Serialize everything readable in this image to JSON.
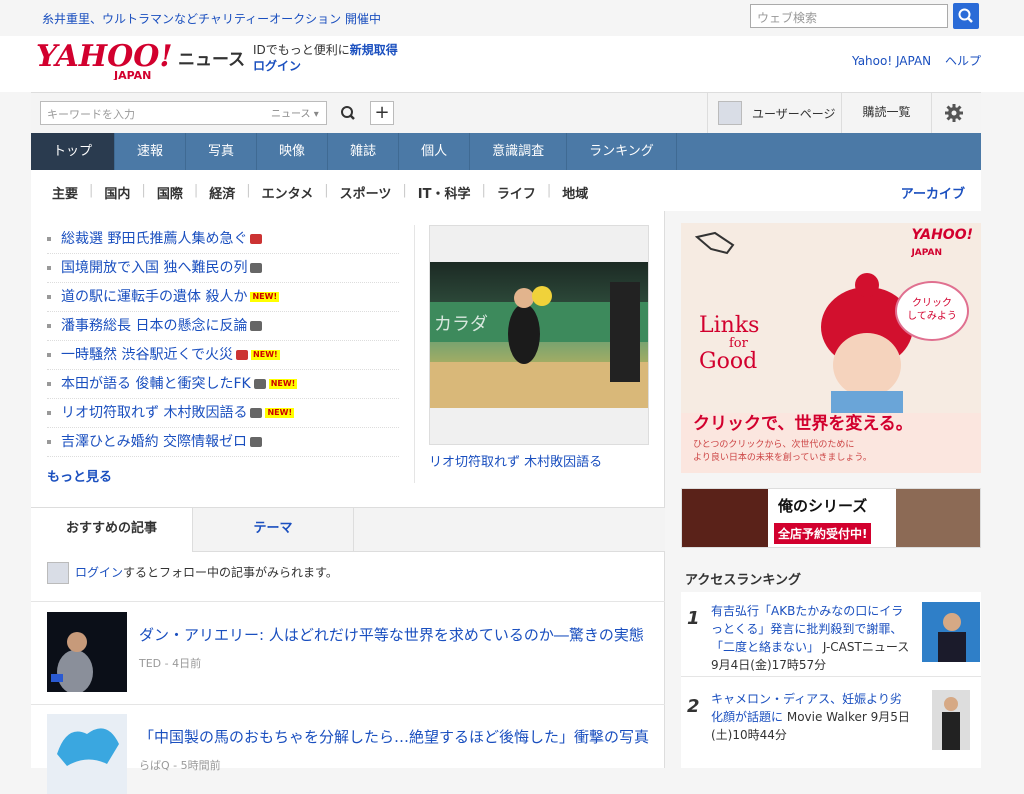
{
  "top": {
    "promo": "糸井重里、ウルトラマンなどチャリティーオークション 開催中",
    "websearch_placeholder": "ウェブ検索"
  },
  "header": {
    "logo_text": "YAHOO!",
    "logo_sub": "JAPAN",
    "section": "ニュース",
    "login_line1_prefix": "IDでもっと便利に",
    "register": "新規取得",
    "login": "ログイン",
    "yahoo_japan": "Yahoo! JAPAN",
    "help": "ヘルプ"
  },
  "search": {
    "placeholder": "キーワードを入力",
    "scope": "ニュース",
    "user_page": "ユーザーページ",
    "subscriptions": "購読一覧"
  },
  "mainnav": [
    "トップ",
    "速報",
    "写真",
    "映像",
    "雑誌",
    "個人",
    "意識調査",
    "ランキング"
  ],
  "subnav": [
    "主要",
    "国内",
    "国際",
    "経済",
    "エンタメ",
    "スポーツ",
    "IT・科学",
    "ライフ",
    "地域"
  ],
  "archive": "アーカイブ",
  "topics": [
    {
      "text": "総裁選 野田氏推薦人集め急ぐ",
      "icon": "video-icon",
      "new": false
    },
    {
      "text": "国境開放で入国 独へ難民の列",
      "icon": "camera-icon",
      "new": false
    },
    {
      "text": "道の駅に運転手の遺体 殺人か",
      "icon": "",
      "new": true
    },
    {
      "text": "潘事務総長 日本の懸念に反論",
      "icon": "camera-icon",
      "new": false
    },
    {
      "text": "一時騒然 渋谷駅近くで火災",
      "icon": "video-icon",
      "new": true
    },
    {
      "text": "本田が語る 俊輔と衝突したFK",
      "icon": "camera-icon",
      "new": true
    },
    {
      "text": "リオ切符取れず 木村敗因語る",
      "icon": "camera-icon",
      "new": true
    },
    {
      "text": "吉澤ひとみ婚約 交際情報ゼロ",
      "icon": "camera-icon",
      "new": false
    }
  ],
  "new_label": "NEW!",
  "more": "もっと見る",
  "photo_caption": "リオ切符取れず 木村敗因語る",
  "tabs": {
    "recommended": "おすすめの記事",
    "theme": "テーマ"
  },
  "login_hint": {
    "link": "ログイン",
    "rest": "するとフォロー中の記事がみられます。"
  },
  "articles": [
    {
      "title": "ダン・アリエリー: 人はどれだけ平等な世界を求めているのか―驚きの実態",
      "source": "TED",
      "time": "4日前"
    },
    {
      "title": "「中国製の馬のおもちゃを分解したら…絶望するほど後悔した」衝撃の写真",
      "source": "らばQ",
      "time": "5時間前"
    }
  ],
  "ads": {
    "ad1_logo": "YAHOO!",
    "ad1_logo_sub": "JAPAN",
    "ad1_links": "Links",
    "ad1_for": "for",
    "ad1_good": "Good",
    "ad1_bubble": "クリック\nしてみよう",
    "ad1_slogan": "クリックで、世界を変える。",
    "ad1_sub1": "ひとつのクリックから、次世代のために",
    "ad1_sub2": "より良い日本の未来を創っていきましょう。",
    "ad2_title": "俺のシリーズ",
    "ad2_sub": "全店予約受付中!"
  },
  "ranking": {
    "title": "アクセスランキング",
    "items": [
      {
        "rank": "1",
        "headline": "有吉弘行「AKBたかみなの口にイラっとくる」発言に批判殺到で謝罪、「二度と絡まない」",
        "source": "J-CASTニュース",
        "time": "9月4日(金)17時57分"
      },
      {
        "rank": "2",
        "headline": "キャメロン・ディアス、妊娠より劣化顔が話題に",
        "source": "Movie Walker",
        "time": "9月5日(土)10時44分"
      }
    ]
  },
  "colors": {
    "nav": "#4b79a6",
    "nav_active": "#2a3b4f",
    "link": "#1a4fbf",
    "yahoo_red": "#d2002e"
  }
}
